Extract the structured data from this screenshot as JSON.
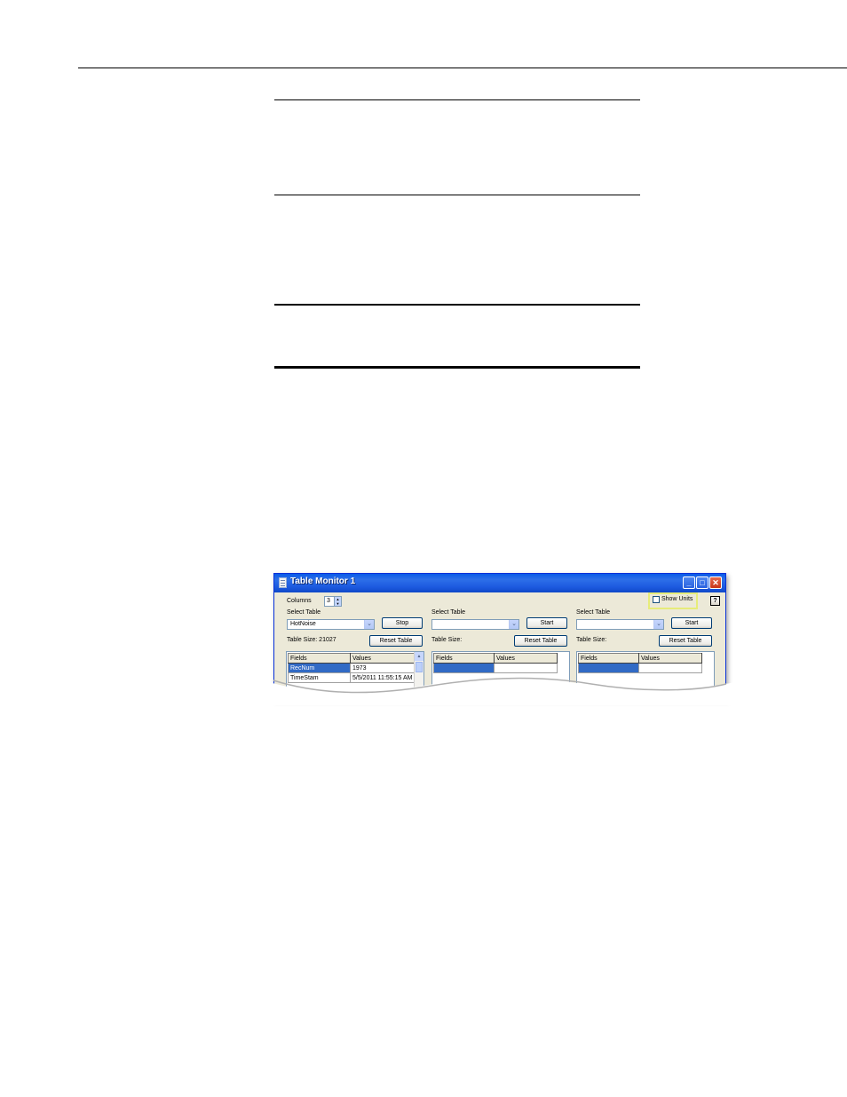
{
  "window": {
    "title": "Table Monitor 1",
    "controls": {
      "minimize": "_",
      "maximize": "□",
      "close": "✕"
    },
    "columns_label": "Columns",
    "columns_value": "3",
    "show_units_label": "Show Units",
    "show_units_checked": false,
    "help_label": "?"
  },
  "columns": [
    {
      "select_label": "Select Table",
      "selected_table": "HotNoise",
      "action_button": "Stop",
      "table_size_label": "Table Size: 21027",
      "reset_button": "Reset Table",
      "grid_headers": [
        "Fields",
        "Values"
      ],
      "rows": [
        {
          "field": "RecNum",
          "value": "1973",
          "selected": true
        },
        {
          "field": "TimeStam",
          "value": "5/5/2011 11:55:15 AM",
          "selected": false
        }
      ]
    },
    {
      "select_label": "Select Table",
      "selected_table": "",
      "action_button": "Start",
      "table_size_label": "Table Size:",
      "reset_button": "Reset Table",
      "grid_headers": [
        "Fields",
        "Values"
      ],
      "rows": [
        {
          "field": "",
          "value": "",
          "selected": true
        }
      ]
    },
    {
      "select_label": "Select Table",
      "selected_table": "",
      "action_button": "Start",
      "table_size_label": "Table Size:",
      "reset_button": "Reset Table",
      "grid_headers": [
        "Fields",
        "Values"
      ],
      "rows": [
        {
          "field": "",
          "value": "",
          "selected": true
        }
      ]
    }
  ],
  "colors": {
    "titlebar": "#0a5be8",
    "selection": "#316ac5",
    "highlight": "#e7ec7a",
    "close_button": "#c8361a"
  }
}
